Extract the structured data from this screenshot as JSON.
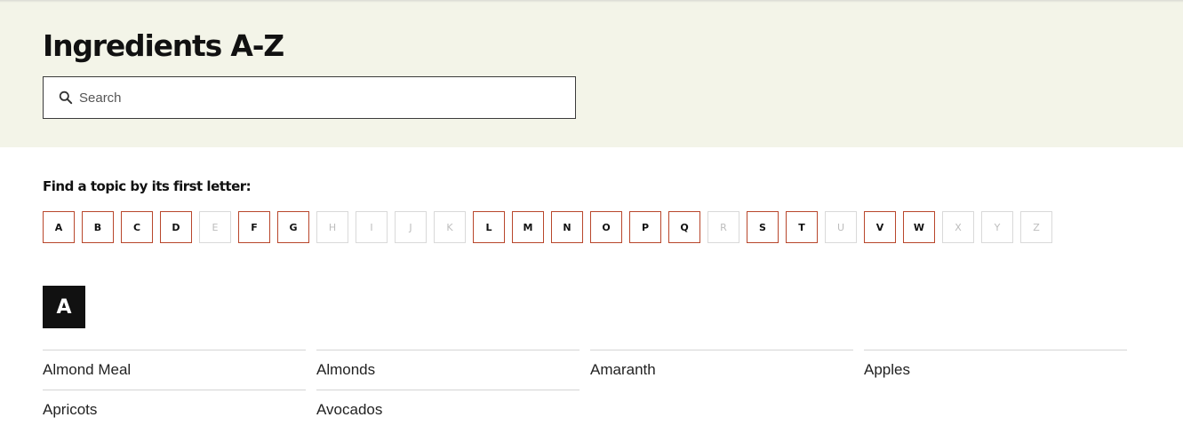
{
  "header": {
    "title": "Ingredients A-Z",
    "search_placeholder": "Search",
    "search_value": ""
  },
  "letter_nav": {
    "label": "Find a topic by its first letter:",
    "letters": [
      {
        "letter": "A",
        "enabled": true
      },
      {
        "letter": "B",
        "enabled": true
      },
      {
        "letter": "C",
        "enabled": true
      },
      {
        "letter": "D",
        "enabled": true
      },
      {
        "letter": "E",
        "enabled": false
      },
      {
        "letter": "F",
        "enabled": true
      },
      {
        "letter": "G",
        "enabled": true
      },
      {
        "letter": "H",
        "enabled": false
      },
      {
        "letter": "I",
        "enabled": false
      },
      {
        "letter": "J",
        "enabled": false
      },
      {
        "letter": "K",
        "enabled": false
      },
      {
        "letter": "L",
        "enabled": true
      },
      {
        "letter": "M",
        "enabled": true
      },
      {
        "letter": "N",
        "enabled": true
      },
      {
        "letter": "O",
        "enabled": true
      },
      {
        "letter": "P",
        "enabled": true
      },
      {
        "letter": "Q",
        "enabled": true
      },
      {
        "letter": "R",
        "enabled": false
      },
      {
        "letter": "S",
        "enabled": true
      },
      {
        "letter": "T",
        "enabled": true
      },
      {
        "letter": "U",
        "enabled": false
      },
      {
        "letter": "V",
        "enabled": true
      },
      {
        "letter": "W",
        "enabled": true
      },
      {
        "letter": "X",
        "enabled": false
      },
      {
        "letter": "Y",
        "enabled": false
      },
      {
        "letter": "Z",
        "enabled": false
      }
    ]
  },
  "section": {
    "letter": "A",
    "items": [
      "Almond Meal",
      "Almonds",
      "Amaranth",
      "Apples",
      "Apricots",
      "Avocados"
    ]
  },
  "colors": {
    "hero_background": "#f3f4e8",
    "letter_border_active": "#b8462b",
    "letter_border_disabled": "#d9d9d9",
    "badge_background": "#111111"
  },
  "icons": {
    "search": "search-icon"
  }
}
